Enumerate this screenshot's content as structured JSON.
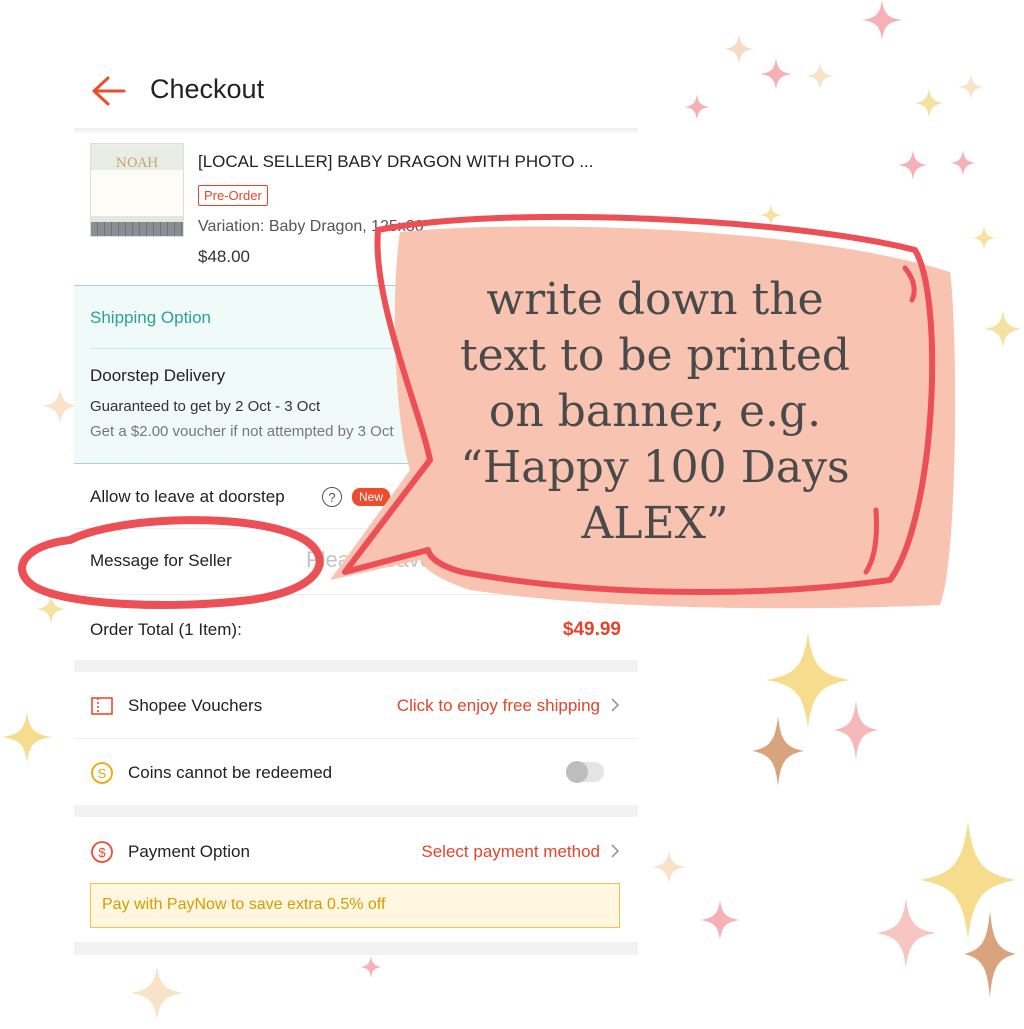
{
  "header": {
    "title": "Checkout",
    "back_icon": "back-arrow-icon"
  },
  "product": {
    "thumb_text": "NOAH",
    "name": "[LOCAL SELLER] BABY DRAGON WITH PHOTO ...",
    "badge": "Pre-Order",
    "variation": "Variation: Baby Dragon, 125x80",
    "price": "$48.00"
  },
  "shipping": {
    "title": "Shipping Option",
    "method": "Doorstep Delivery",
    "guarantee": "Guaranteed to get by 2 Oct - 3 Oct",
    "voucher_note": "Get a $2.00 voucher if not attempted by 3 Oct"
  },
  "leave_at_doorstep": {
    "label": "Allow to leave at doorstep",
    "help_glyph": "?",
    "badge": "New"
  },
  "message": {
    "label": "Message for Seller",
    "placeholder": "Please leave a message"
  },
  "order_total": {
    "label": "Order Total (1 Item):",
    "amount": "$49.99"
  },
  "vouchers": {
    "label": "Shopee Vouchers",
    "link": "Click to enjoy free shipping",
    "icon": "voucher-icon"
  },
  "coins": {
    "label": "Coins cannot be redeemed",
    "icon": "coin-icon",
    "toggle_on": false
  },
  "payment": {
    "label": "Payment Option",
    "link": "Select payment method",
    "icon": "dollar-icon"
  },
  "paynow_banner": "Pay with PayNow to save extra 0.5% off",
  "callout": {
    "lines": [
      "write down the",
      "text to be printed",
      "on banner, e.g.",
      "“Happy 100 Days",
      "ALEX”"
    ]
  },
  "colors": {
    "accent": "#ee4d2d",
    "teal": "#2aa394",
    "bubble_fill": "#f9c3b1",
    "bubble_stroke": "#ec4f55"
  }
}
